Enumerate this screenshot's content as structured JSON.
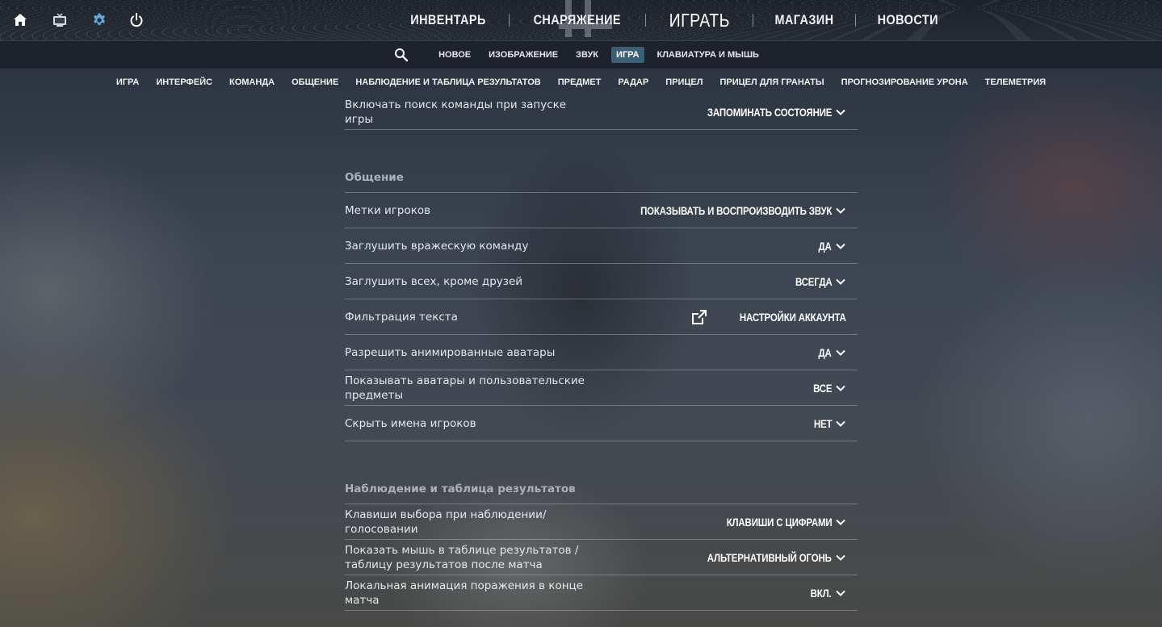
{
  "top_icons": [
    "home-icon",
    "tv-icon",
    "gear-icon",
    "power-icon"
  ],
  "main_nav": {
    "inventory": "Инвентарь",
    "loadout": "Снаряжение",
    "play": "Играть",
    "store": "Магазин",
    "news": "Новости"
  },
  "sub_nav": {
    "new": "Новое",
    "video": "Изображение",
    "audio": "Звук",
    "game": "Игра",
    "keyboard": "Клавиатура и мышь"
  },
  "categories": {
    "game": "Игра",
    "interface": "Интерфейс",
    "team": "Команда",
    "communication": "Общение",
    "spectating": "Наблюдение и таблица результатов",
    "item": "Предмет",
    "radar": "Радар",
    "crosshair": "Прицел",
    "grenade_crosshair": "Прицел для гранаты",
    "damage_prediction": "Прогнозирование урона",
    "telemetry": "Телеметрия"
  },
  "settings": {
    "top_row": {
      "label": "Включать поиск команды при запуске игры",
      "value": "Запоминать состояние"
    },
    "communication": {
      "heading": "Общение",
      "rows": [
        {
          "label": "Метки игроков",
          "value": "Показывать и воспроизводить звук"
        },
        {
          "label": "Заглушить вражескую команду",
          "value": "Да"
        },
        {
          "label": "Заглушить всех, кроме друзей",
          "value": "Всегда"
        },
        {
          "label": "Фильтрация текста",
          "value": "Настройки аккаунта"
        },
        {
          "label": "Разрешить анимированные аватары",
          "value": "Да"
        },
        {
          "label": "Показывать аватары и пользовательские предметы",
          "value": "Все"
        },
        {
          "label": "Скрыть имена игроков",
          "value": "Нет"
        }
      ]
    },
    "spectating": {
      "heading": "Наблюдение и таблица результатов",
      "rows": [
        {
          "label": "Клавиши выбора при наблюдении/голосовании",
          "value": "Клавиши с цифрами"
        },
        {
          "label": "Показать мышь в таблице результатов / таблицу результатов после матча",
          "value": "Альтернативный огонь"
        },
        {
          "label": "Локальная анимация поражения в конце матча",
          "value": "Вкл."
        }
      ]
    }
  },
  "colors": {
    "active_tab": "#3b5f77",
    "top_bar": "#1d2129"
  }
}
